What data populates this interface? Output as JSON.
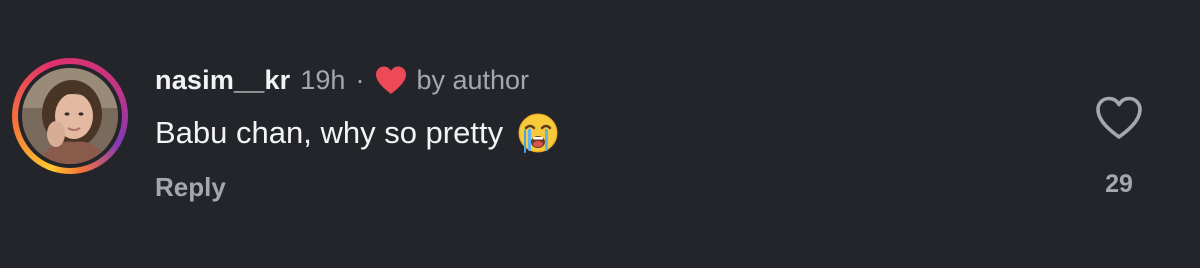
{
  "comment": {
    "username": "nasim__kr",
    "time": "19h",
    "separator": "·",
    "author_like_label": "by author",
    "text": "Babu chan, why so pretty",
    "emoji": "loudly-crying-face",
    "reply_label": "Reply",
    "like_count": "29"
  },
  "colors": {
    "background": "#23252b",
    "primary_text": "#f2f3f5",
    "secondary_text": "#a4a7ae",
    "author_heart": "#ed4956"
  },
  "icons": {
    "author_heart": "heart-icon",
    "like": "heart-outline-icon"
  }
}
